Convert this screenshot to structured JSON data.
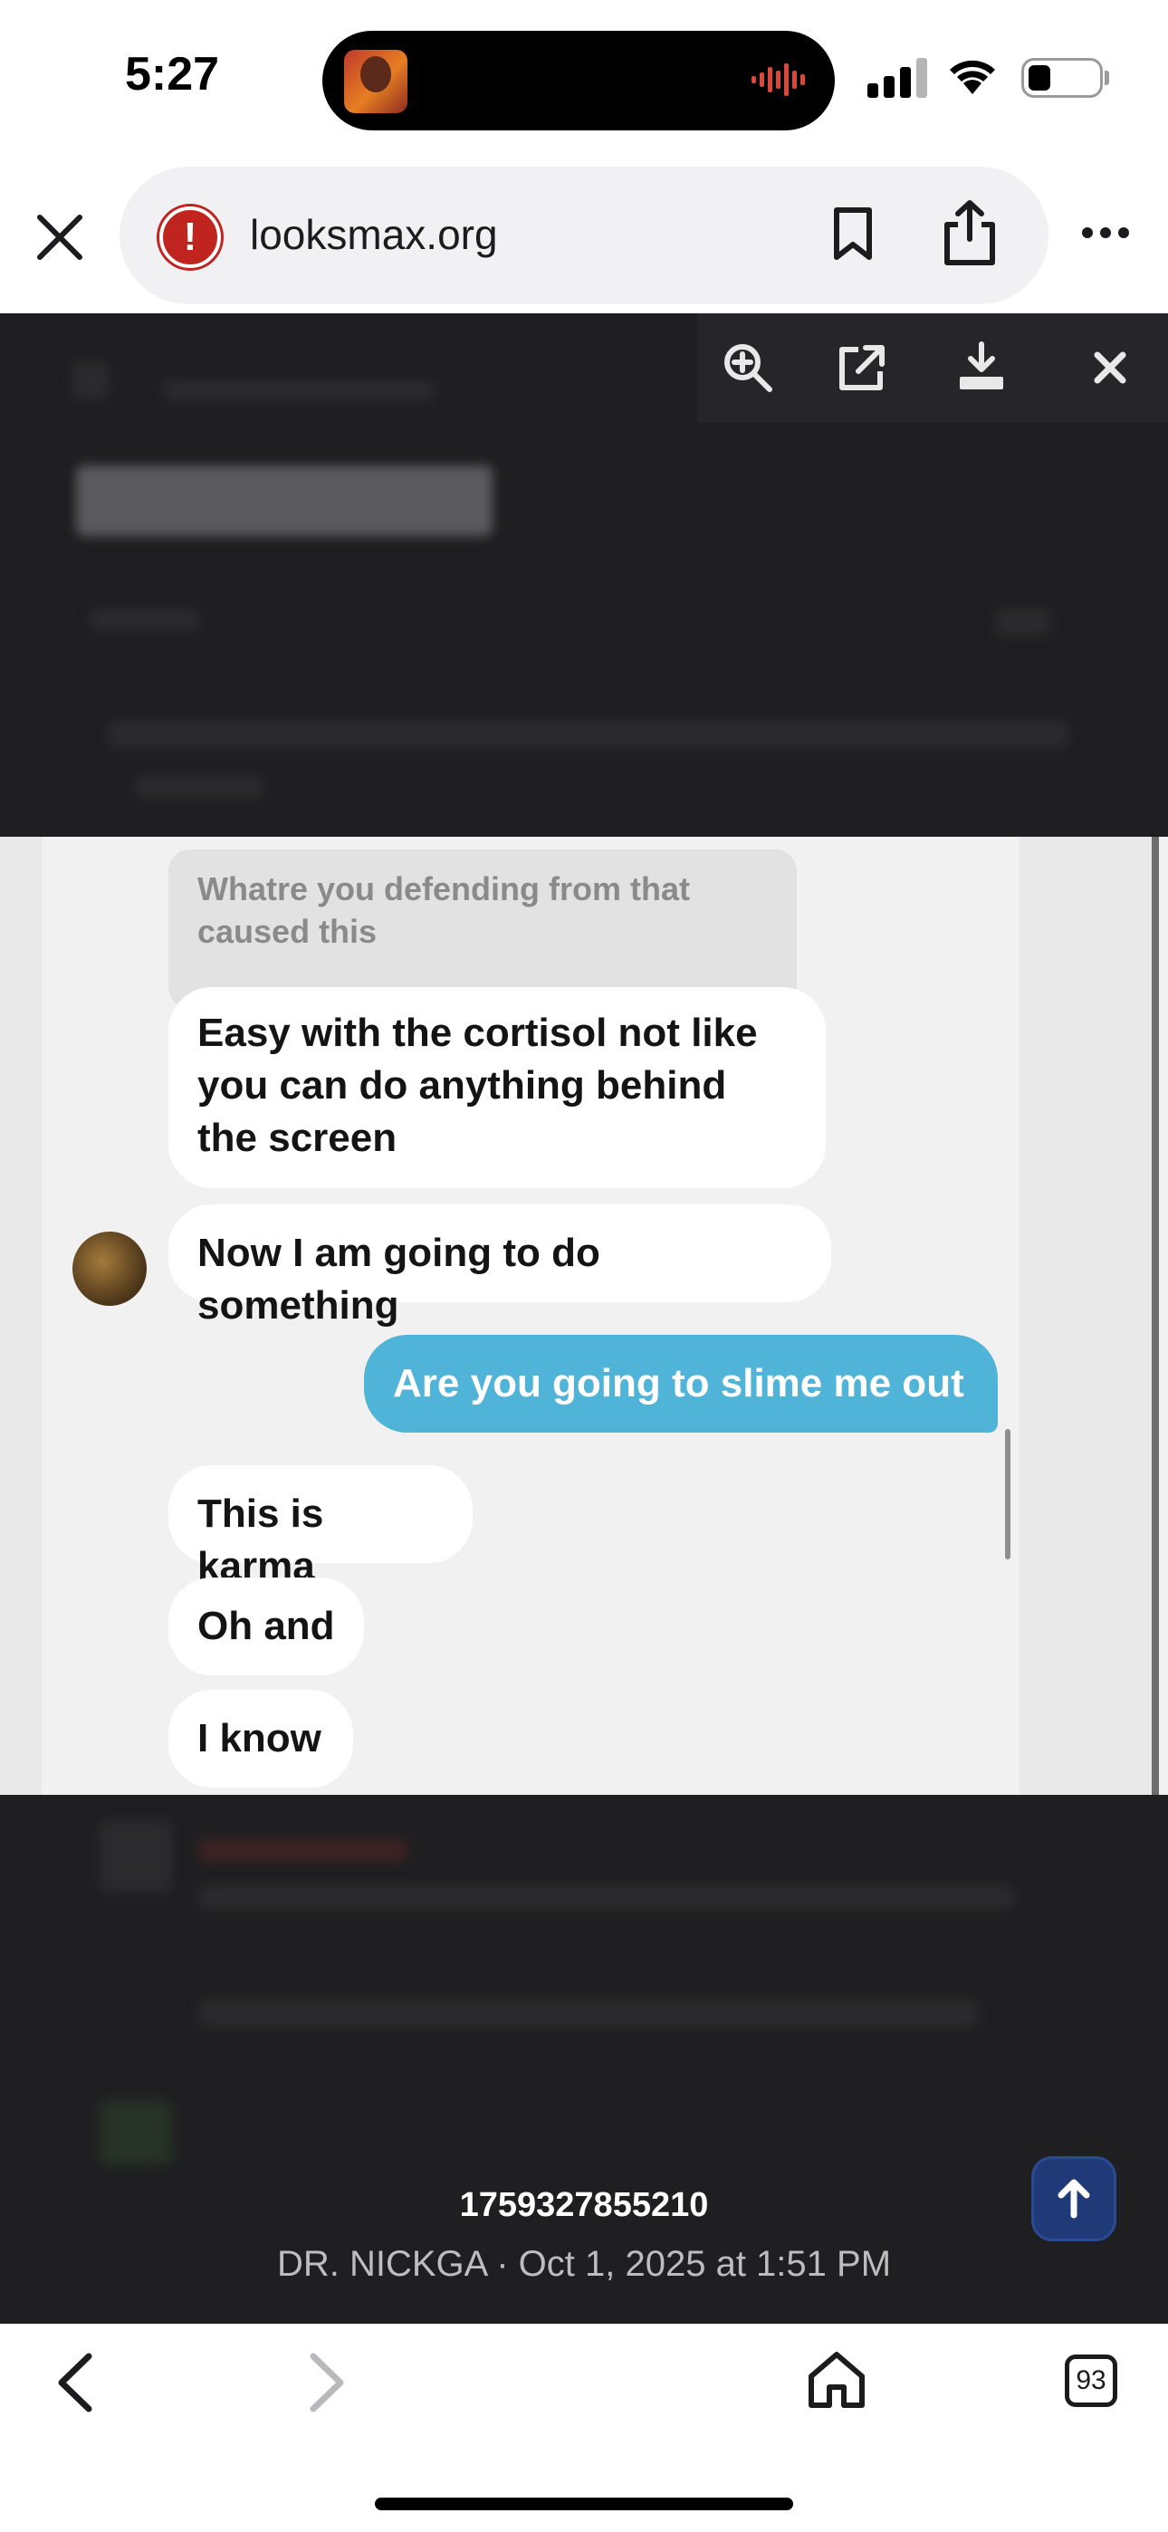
{
  "status_bar": {
    "time": "5:27",
    "icons": [
      "now-playing-art",
      "waveform-icon",
      "signal-icon",
      "wifi-icon",
      "battery-icon"
    ]
  },
  "browser": {
    "url": "looksmax.org",
    "security_badge": "!",
    "buttons": [
      "close-icon",
      "bookmark-icon",
      "share-icon",
      "more-icon"
    ]
  },
  "lightbox": {
    "tools": [
      "zoom-in-icon",
      "open-external-icon",
      "download-icon",
      "close-icon"
    ],
    "caption": {
      "title": "1759327855210",
      "meta": "DR. NICKGA · Oct 1, 2025 at 1:51 PM"
    }
  },
  "chat": {
    "quoted": "Whatre you defending from that caused this",
    "messages": [
      {
        "side": "in",
        "text": "Easy with the cortisol not like you can do anything behind the screen"
      },
      {
        "side": "in",
        "text": "Now I am going to do something"
      },
      {
        "side": "out",
        "text": "Are you going to slime me out"
      },
      {
        "side": "in",
        "text": "This is karma"
      },
      {
        "side": "in",
        "text": "Oh and"
      },
      {
        "side": "in",
        "text": "I know"
      }
    ],
    "colors": {
      "outgoing": "#50b3d8",
      "incoming": "#ffffff"
    }
  },
  "bottom_toolbar": {
    "tab_count": "93",
    "buttons": [
      "back-icon",
      "forward-icon",
      "home-icon",
      "tabs-icon"
    ]
  }
}
